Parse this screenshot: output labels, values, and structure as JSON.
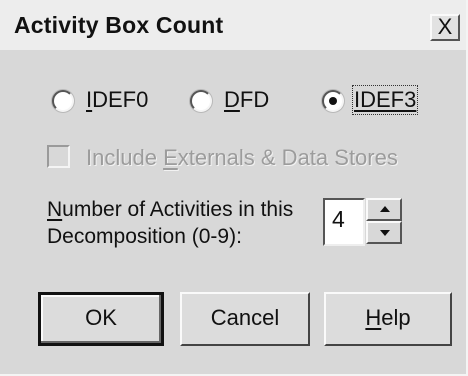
{
  "window": {
    "title": "Activity Box Count",
    "close_label": "X"
  },
  "method": {
    "options": [
      {
        "pre": "",
        "hot": "I",
        "post": "DEF0",
        "checked": false
      },
      {
        "pre": "",
        "hot": "D",
        "post": "FD",
        "checked": false
      },
      {
        "pre": "",
        "hot": "",
        "post": "IDEF3",
        "checked": true
      }
    ]
  },
  "include_externals": {
    "pre": "Include ",
    "hot": "E",
    "post": "xternals & Data Stores",
    "checked": false,
    "enabled": false
  },
  "activities": {
    "label_pre": "",
    "label_hot": "N",
    "label_post": "umber of Activities in this",
    "label_line2": "Decomposition (0-9):",
    "value": "4"
  },
  "buttons": {
    "ok": "OK",
    "cancel": "Cancel",
    "help_hot": "H",
    "help_post": "elp"
  }
}
